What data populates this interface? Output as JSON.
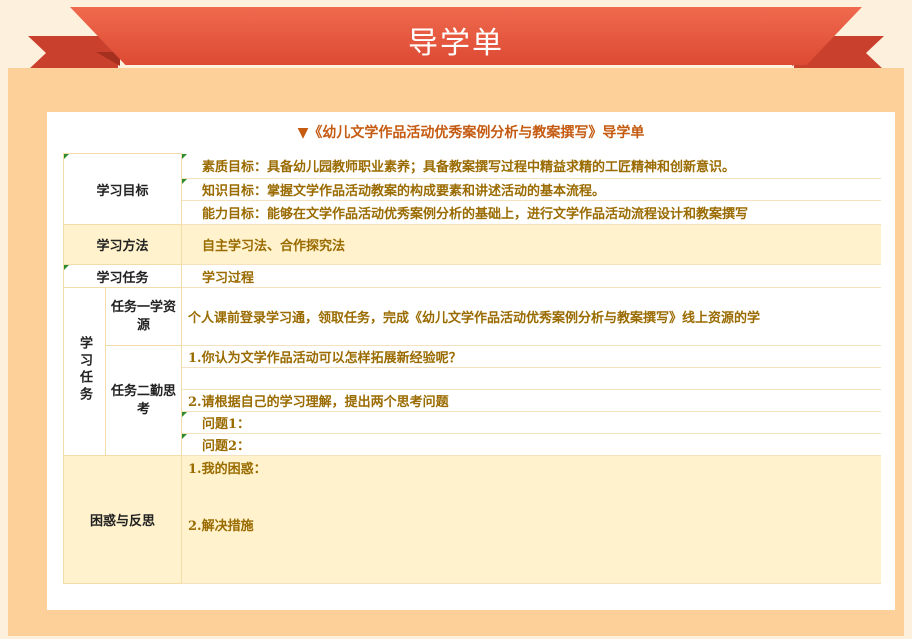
{
  "header": {
    "title": "导学单"
  },
  "document": {
    "title": "▼《幼儿文学作品活动优秀案例分析与教案撰写》导学单"
  },
  "sections": {
    "goals": {
      "label": "学习目标",
      "items": [
        "素质目标：具备幼儿园教师职业素养；具备教案撰写过程中精益求精的工匠精神和创新意识。",
        "知识目标：掌握文学作品活动教案的构成要素和讲述活动的基本流程。",
        "能力目标：能够在文学作品活动优秀案例分析的基础上，进行文学作品活动流程设计和教案撰写"
      ]
    },
    "methods": {
      "label": "学习方法",
      "value": "自主学习法、合作探究法"
    },
    "tasks_header": {
      "label": "学习任务",
      "value": "学习过程"
    },
    "tasks": {
      "label": "学习任务",
      "task1": {
        "label": "任务一学资源",
        "value": "个人课前登录学习通，领取任务，完成《幼儿文学作品活动优秀案例分析与教案撰写》线上资源的学"
      },
      "task2": {
        "label": "任务二勤思考",
        "q1": "1.你认为文学作品活动可以怎样拓展新经验呢？",
        "q2": "2.请根据自己的学习理解，提出两个思考问题",
        "sub1": "问题1：",
        "sub2": "问题2："
      }
    },
    "reflection": {
      "label": "困惑与反思",
      "item1": "1.我的困惑：",
      "item2": "2.解决措施"
    }
  },
  "colors": {
    "ribbon": "#dd4a33",
    "frame": "#fdd09a",
    "accent_text": "#9a6b00",
    "shade": "#fff2cc"
  }
}
